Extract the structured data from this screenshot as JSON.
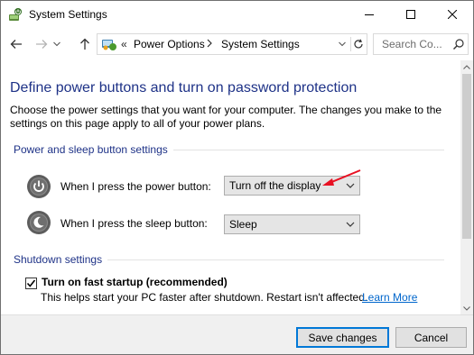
{
  "window": {
    "title": "System Settings",
    "icon": "power-options-icon"
  },
  "titlebar_buttons": {
    "minimize": "minimize-icon",
    "maximize": "maximize-icon",
    "close": "close-icon"
  },
  "navigation": {
    "overflow_chevron": "«",
    "breadcrumbs": [
      "Power Options",
      "System Settings"
    ],
    "search_placeholder": "Search Co..."
  },
  "main": {
    "title": "Define power buttons and turn on password protection",
    "description": "Choose the power settings that you want for your computer. The changes you make to the settings on this page apply to all of your power plans.",
    "power_sleep_group": {
      "label": "Power and sleep button settings",
      "rows": [
        {
          "label": "When I press the power button:",
          "value": "Turn off the display",
          "icon": "power-button-icon"
        },
        {
          "label": "When I press the sleep button:",
          "value": "Sleep",
          "icon": "sleep-button-icon"
        }
      ]
    },
    "shutdown_group": {
      "label": "Shutdown settings",
      "fast_startup": {
        "label": "Turn on fast startup (recommended)",
        "checked": true,
        "help": "This helps start your PC faster after shutdown. Restart isn't affected.",
        "link": "Learn More"
      }
    }
  },
  "footer": {
    "save_label": "Save changes",
    "cancel_label": "Cancel"
  },
  "colors": {
    "heading": "#1e3287",
    "link": "#0066cc",
    "annotation_arrow": "#e81123",
    "default_button_border": "#0078d7"
  }
}
